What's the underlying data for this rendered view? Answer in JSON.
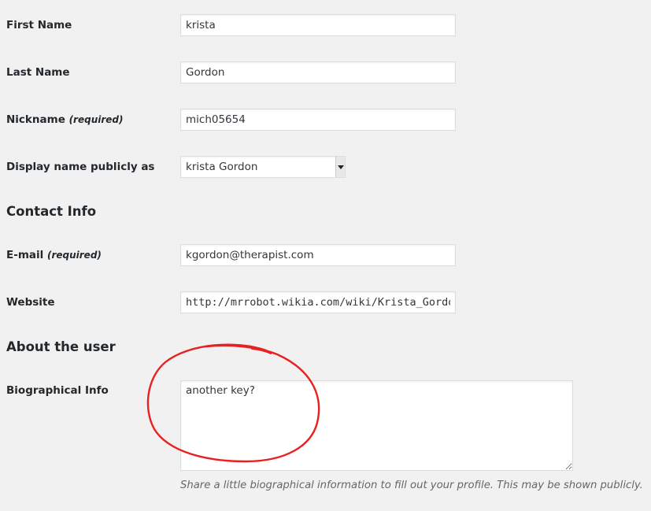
{
  "form": {
    "first_name": {
      "label": "First Name",
      "value": "krista"
    },
    "last_name": {
      "label": "Last Name",
      "value": "Gordon"
    },
    "nickname": {
      "label": "Nickname",
      "required": "(required)",
      "value": "mich05654"
    },
    "display_name": {
      "label": "Display name publicly as",
      "selected": "krista Gordon"
    }
  },
  "contact": {
    "heading": "Contact Info",
    "email": {
      "label": "E-mail",
      "required": "(required)",
      "value": "kgordon@therapist.com"
    },
    "website": {
      "label": "Website",
      "value": "http://mrrobot.wikia.com/wiki/Krista_Gordon"
    }
  },
  "about": {
    "heading": "About the user",
    "bio": {
      "label": "Biographical Info",
      "value": "another key?",
      "description": "Share a little biographical information to fill out your profile. This may be shown publicly."
    }
  },
  "annotation": {
    "color": "#e8201f",
    "shape": "hand-drawn-circle"
  }
}
